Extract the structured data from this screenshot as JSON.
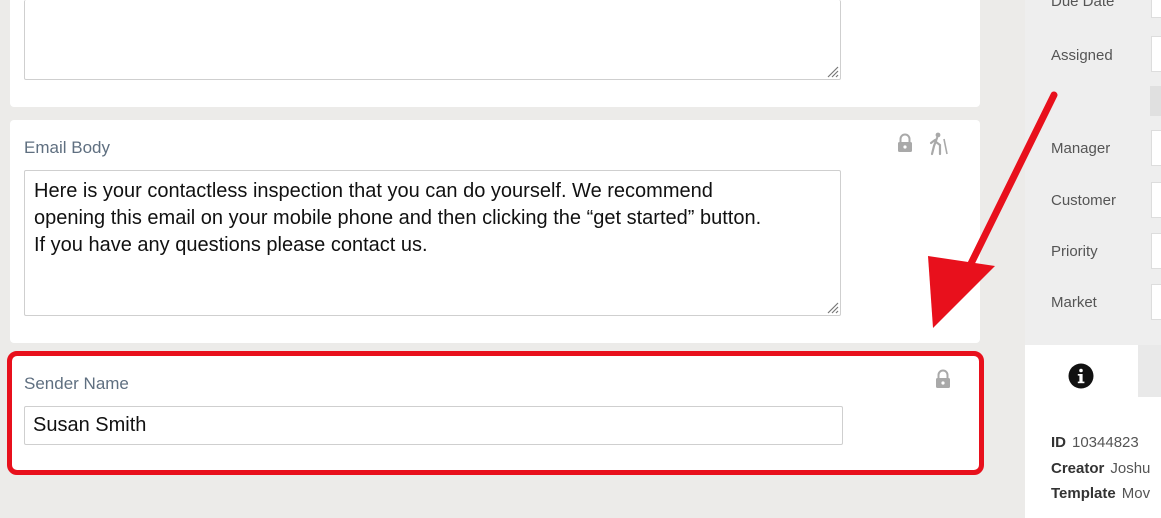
{
  "top_field": {
    "value": ""
  },
  "email_body": {
    "label": "Email Body",
    "lines": [
      "Here is your contactless inspection that you can do yourself.  We recommend",
      "opening this email on your mobile phone and then clicking the “get started” button.",
      "If you have any questions please contact us."
    ],
    "icons": [
      "lock-icon",
      "hiker-icon"
    ]
  },
  "sender_name": {
    "label": "Sender Name",
    "value": "Susan Smith",
    "icons": [
      "lock-icon"
    ]
  },
  "annotation": {
    "color": "#e8101c"
  },
  "right_panel": {
    "labels": {
      "due_date": "Due Date",
      "assigned": "Assigned",
      "manager": "Manager",
      "customer": "Customer",
      "priority": "Priority",
      "market": "Market"
    },
    "info_tab_icon": "info-icon",
    "meta": {
      "id_label": "ID",
      "id_value": "10344823",
      "creator_label": "Creator",
      "creator_value": "Joshu",
      "template_label": "Template",
      "template_value": "Mov"
    }
  }
}
